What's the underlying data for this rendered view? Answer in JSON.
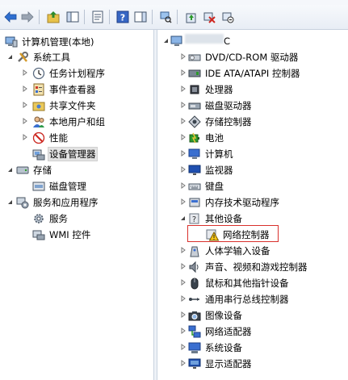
{
  "left_tree": {
    "root": "计算机管理(本地)",
    "system_tools": "系统工具",
    "task_scheduler": "任务计划程序",
    "event_viewer": "事件查看器",
    "shared_folders": "共享文件夹",
    "local_users": "本地用户和组",
    "performance": "性能",
    "device_manager": "设备管理器",
    "storage": "存储",
    "disk_management": "磁盘管理",
    "services_apps": "服务和应用程序",
    "services": "服务",
    "wmi": "WMI 控件"
  },
  "right_tree": {
    "computer_suffix": "C",
    "dvd": "DVD/CD-ROM 驱动器",
    "ide": "IDE ATA/ATAPI 控制器",
    "processor": "处理器",
    "disk_drives": "磁盘驱动器",
    "storage_controllers": "存储控制器",
    "battery": "电池",
    "computer": "计算机",
    "monitors": "监视器",
    "keyboard": "键盘",
    "memory_tech": "内存技术驱动程序",
    "other_devices": "其他设备",
    "network_controller": "网络控制器",
    "hid": "人体学输入设备",
    "sound": "声音、视频和游戏控制器",
    "mice": "鼠标和其他指针设备",
    "usb": "通用串行总线控制器",
    "imaging": "图像设备",
    "network_adapters": "网络适配器",
    "system_devices": "系统设备",
    "display_adapters": "显示适配器"
  }
}
